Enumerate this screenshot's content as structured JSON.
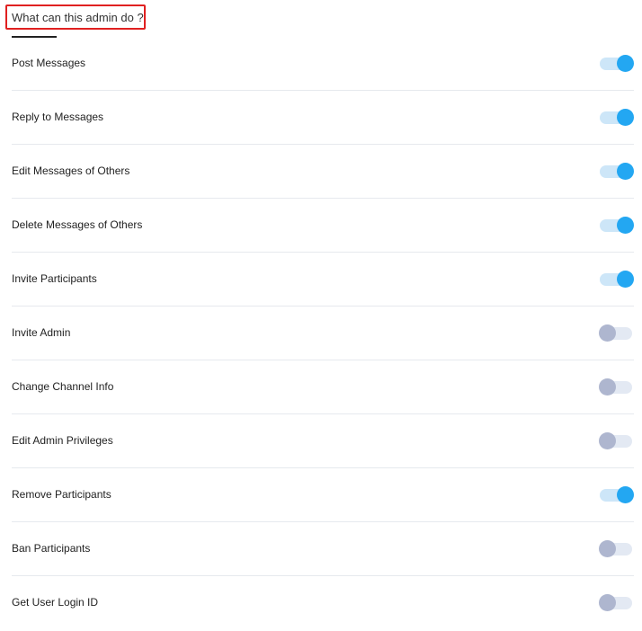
{
  "section": {
    "title": "What can this admin do ?"
  },
  "colors": {
    "highlight_border": "#e02020",
    "toggle_on_thumb": "#23a7f2",
    "toggle_on_track": "#cde6f8",
    "toggle_off_thumb": "#aeb6cf",
    "toggle_off_track": "#e3e9f3"
  },
  "permissions": [
    {
      "label": "Post Messages",
      "enabled": true
    },
    {
      "label": "Reply to Messages",
      "enabled": true
    },
    {
      "label": "Edit Messages of Others",
      "enabled": true
    },
    {
      "label": "Delete Messages of Others",
      "enabled": true
    },
    {
      "label": "Invite Participants",
      "enabled": true
    },
    {
      "label": "Invite Admin",
      "enabled": false
    },
    {
      "label": "Change Channel Info",
      "enabled": false
    },
    {
      "label": "Edit Admin Privileges",
      "enabled": false
    },
    {
      "label": "Remove Participants",
      "enabled": true
    },
    {
      "label": "Ban Participants",
      "enabled": false
    },
    {
      "label": "Get User Login ID",
      "enabled": false
    }
  ]
}
